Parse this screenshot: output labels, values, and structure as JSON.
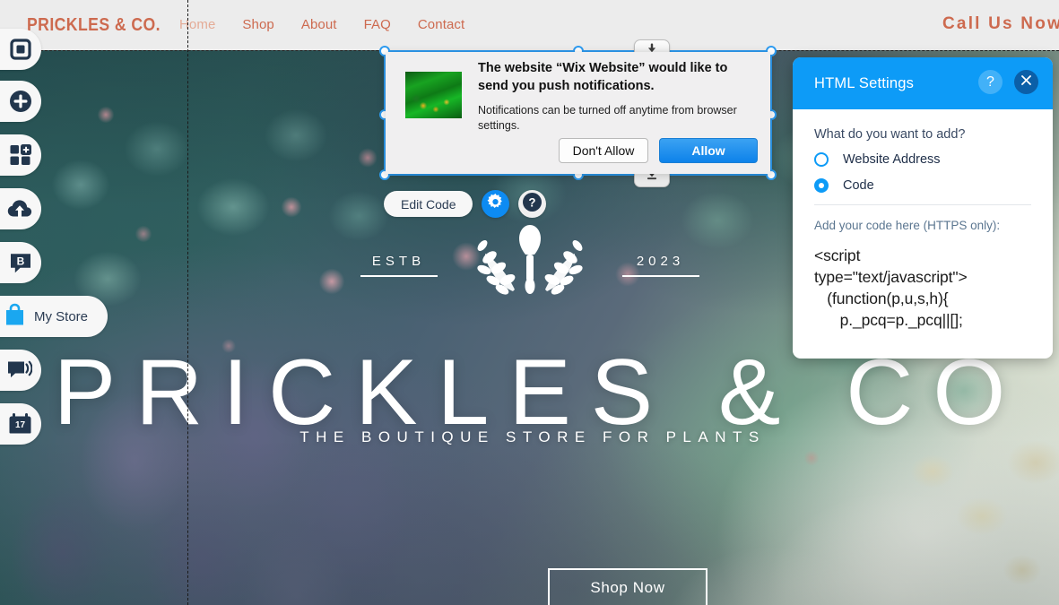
{
  "site": {
    "logo": "PRICKLES & CO.",
    "nav": [
      {
        "label": "Home",
        "active": true
      },
      {
        "label": "Shop",
        "active": false
      },
      {
        "label": "About",
        "active": false
      },
      {
        "label": "FAQ",
        "active": false
      },
      {
        "label": "Contact",
        "active": false
      }
    ],
    "cta": "Call Us Now",
    "accent_color": "#cd6a4f"
  },
  "hero": {
    "estb_label": "ESTB",
    "estb_year": "2023",
    "title": "PRICKLES & CO",
    "subtitle": "THE BOUTIQUE STORE FOR PLANTS",
    "button": "Shop Now"
  },
  "left_rail": {
    "items": [
      {
        "name": "pages-menu",
        "icon": "square-outline-icon"
      },
      {
        "name": "add-element",
        "icon": "plus-circle-icon"
      },
      {
        "name": "add-apps",
        "icon": "apps-grid-icon"
      },
      {
        "name": "media-manager",
        "icon": "cloud-upload-icon"
      },
      {
        "name": "blog",
        "icon": "blog-bubble-icon"
      }
    ],
    "store_pill": {
      "label": "My Store",
      "icon": "shopping-bag-icon"
    },
    "lower_items": [
      {
        "name": "chat",
        "icon": "speech-bubble-icon"
      },
      {
        "name": "bookings",
        "icon": "calendar-icon",
        "badge": "17"
      }
    ]
  },
  "editor": {
    "edit_code_label": "Edit Code",
    "gear_icon": "gear-icon",
    "help_icon": "question-mark-icon",
    "drag_icon": "download-arrow-icon",
    "selection_color": "#2d9bf0"
  },
  "push_dialog": {
    "title": "The website “Wix Website” would like to send you push notifications.",
    "body": "Notifications can be turned off anytime from browser settings.",
    "deny_label": "Don't Allow",
    "allow_label": "Allow",
    "allow_color": "#0d82ea"
  },
  "settings_panel": {
    "title": "HTML Settings",
    "help_glyph": "?",
    "close_glyph": "×",
    "question": "What do you want to add?",
    "options": [
      {
        "label": "Website Address",
        "selected": false
      },
      {
        "label": "Code",
        "selected": true
      }
    ],
    "code_label": "Add your code here (HTTPS only):",
    "code_value": "<script\ntype=\"text/javascript\">\n   (function(p,u,s,h){\n      p._pcq=p._pcq||[];",
    "accent_color": "#0d9bf7"
  }
}
